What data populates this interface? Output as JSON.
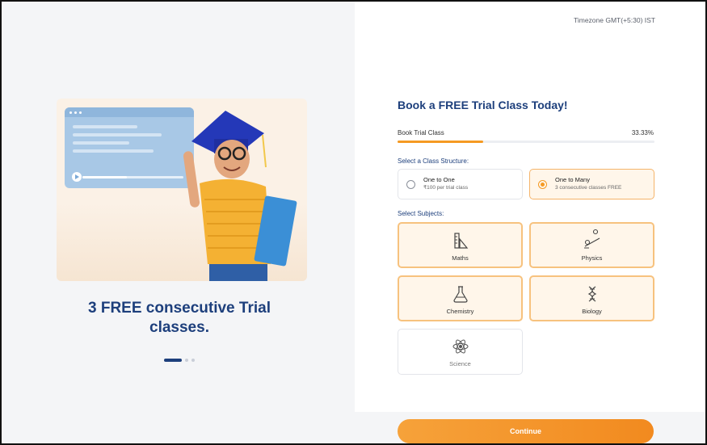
{
  "header": {
    "timezone": "Timezone GMT(+5:30) IST"
  },
  "promo": {
    "tagline": "3 FREE consecutive Trial classes.",
    "carousel": {
      "active_index": 0,
      "count": 3
    }
  },
  "booking": {
    "title": "Book a FREE Trial Class Today!",
    "progress": {
      "label": "Book Trial Class",
      "percent_text": "33.33%",
      "value": 33.33
    },
    "structure_label": "Select a Class Structure:",
    "structures": [
      {
        "title": "One to One",
        "subtitle": "₹100 per trial class",
        "selected": false
      },
      {
        "title": "One to Many",
        "subtitle": "3 consecutive classes FREE",
        "selected": true
      }
    ],
    "subjects_label": "Select Subjects:",
    "subjects": [
      {
        "label": "Maths",
        "icon": "ruler-icon",
        "selected": true
      },
      {
        "label": "Physics",
        "icon": "pendulum-icon",
        "selected": true
      },
      {
        "label": "Chemistry",
        "icon": "flask-icon",
        "selected": true
      },
      {
        "label": "Biology",
        "icon": "dna-icon",
        "selected": true
      },
      {
        "label": "Science",
        "icon": "atom-icon",
        "selected": false
      }
    ],
    "continue_label": "Continue"
  },
  "colors": {
    "accent": "#f59a23",
    "brand": "#1d3f7c",
    "selected_bg": "#fff6ea"
  }
}
